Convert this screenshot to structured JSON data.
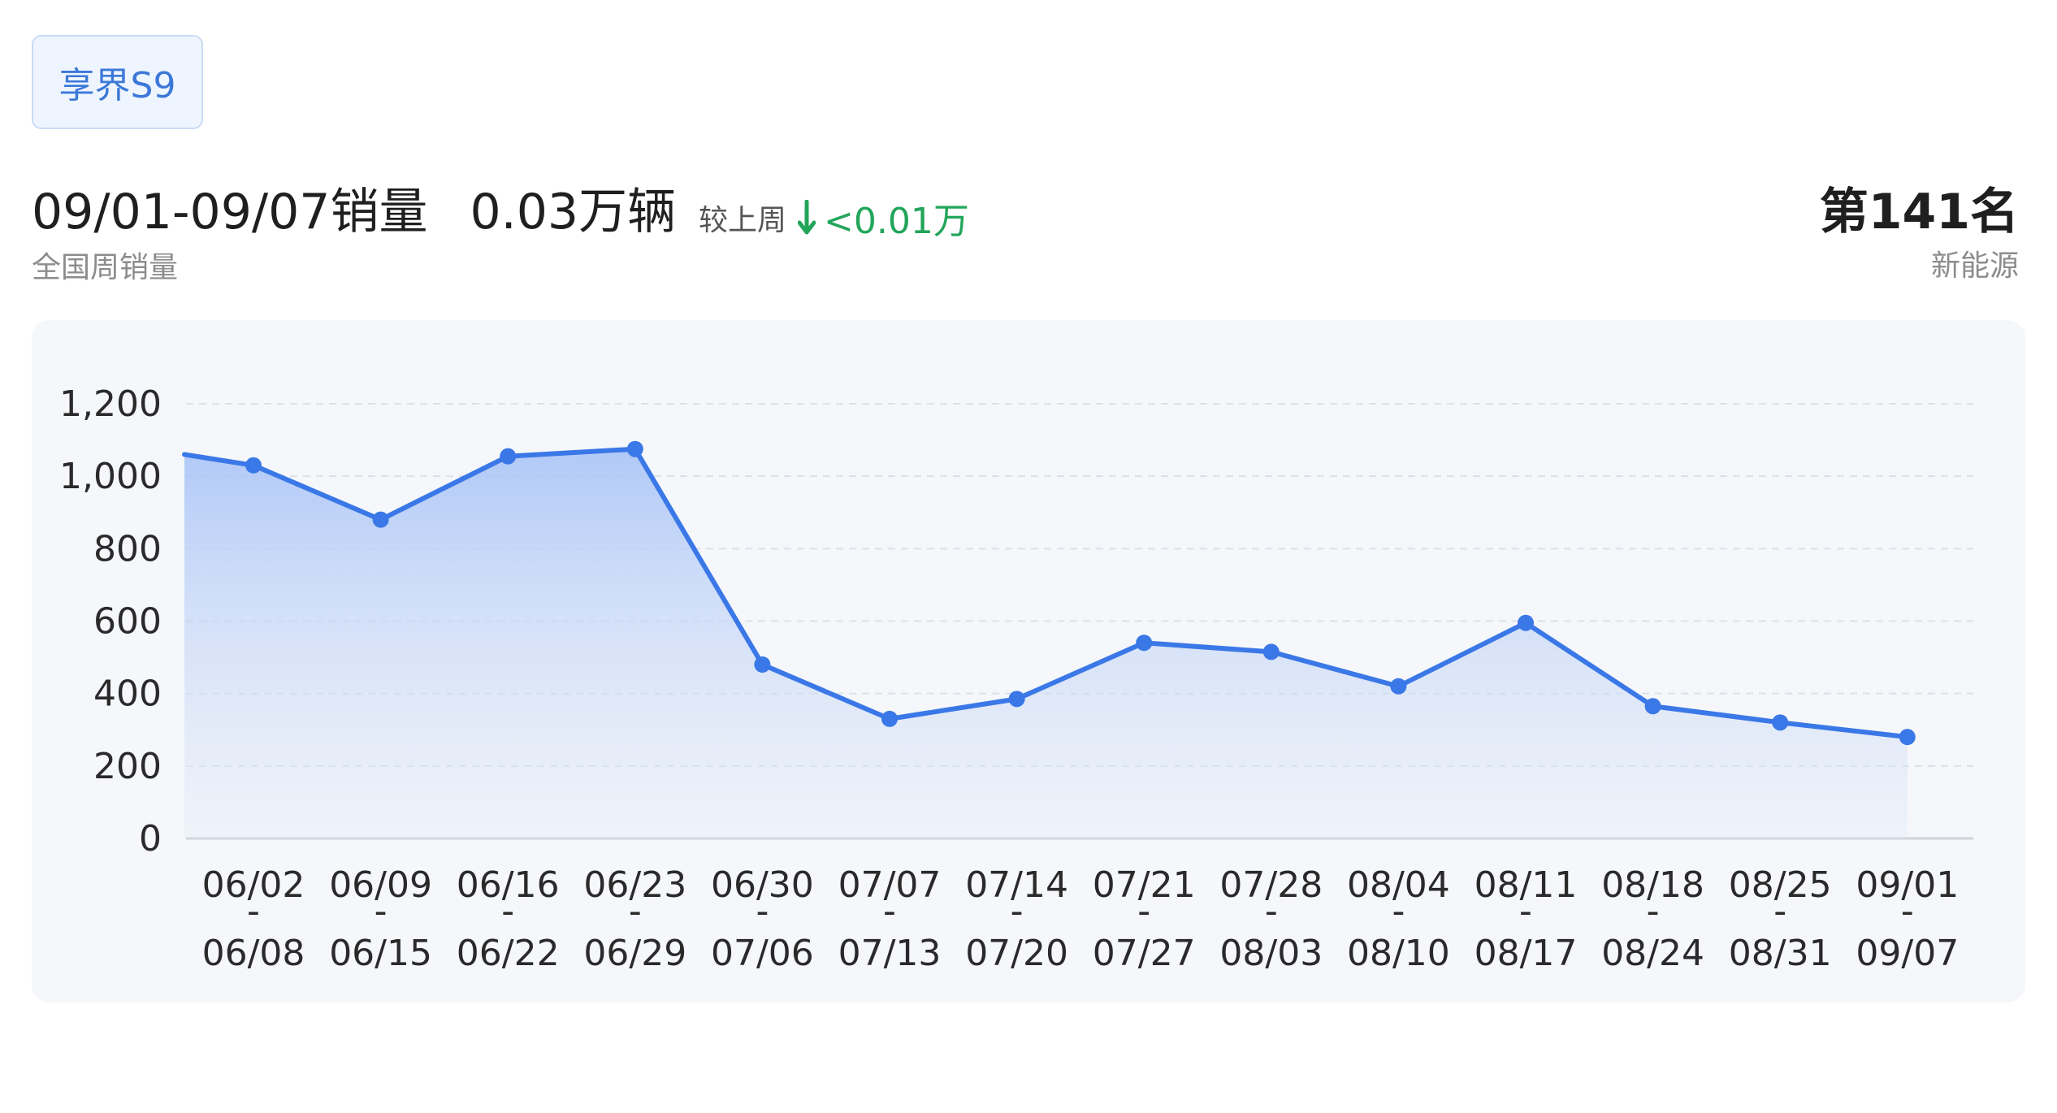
{
  "model_chip": "享界S9",
  "headline": {
    "period_label": "09/01-09/07销量",
    "volume": "0.03万辆",
    "compare_label": "较上周",
    "delta": "<0.01万",
    "delta_direction": "down",
    "delta_color": "#22a55a"
  },
  "subtitle": "全国周销量",
  "rank": {
    "position": "第141名",
    "category": "新能源"
  },
  "colors": {
    "line": "#3b78e7",
    "chip_text": "#3c78d8",
    "chip_bg": "#eef5fe"
  },
  "chart_data": {
    "type": "area",
    "title": "",
    "xlabel": "",
    "ylabel": "",
    "ylim": [
      0,
      1200
    ],
    "yticks": [
      "0",
      "200",
      "400",
      "600",
      "800",
      "1,000",
      "1,200"
    ],
    "grid": true,
    "categories": [
      [
        "06/02",
        "-",
        "06/08"
      ],
      [
        "06/09",
        "-",
        "06/15"
      ],
      [
        "06/16",
        "-",
        "06/22"
      ],
      [
        "06/23",
        "-",
        "06/29"
      ],
      [
        "06/30",
        "-",
        "07/06"
      ],
      [
        "07/07",
        "-",
        "07/13"
      ],
      [
        "07/14",
        "-",
        "07/20"
      ],
      [
        "07/21",
        "-",
        "07/27"
      ],
      [
        "07/28",
        "-",
        "08/03"
      ],
      [
        "08/04",
        "-",
        "08/10"
      ],
      [
        "08/11",
        "-",
        "08/17"
      ],
      [
        "08/18",
        "-",
        "08/24"
      ],
      [
        "08/25",
        "-",
        "08/31"
      ],
      [
        "09/01",
        "-",
        "09/07"
      ]
    ],
    "series": [
      {
        "values": [
          1030,
          880,
          1055,
          1075,
          480,
          330,
          385,
          540,
          515,
          420,
          595,
          365,
          320,
          280
        ]
      }
    ],
    "prev_value": 1060
  }
}
